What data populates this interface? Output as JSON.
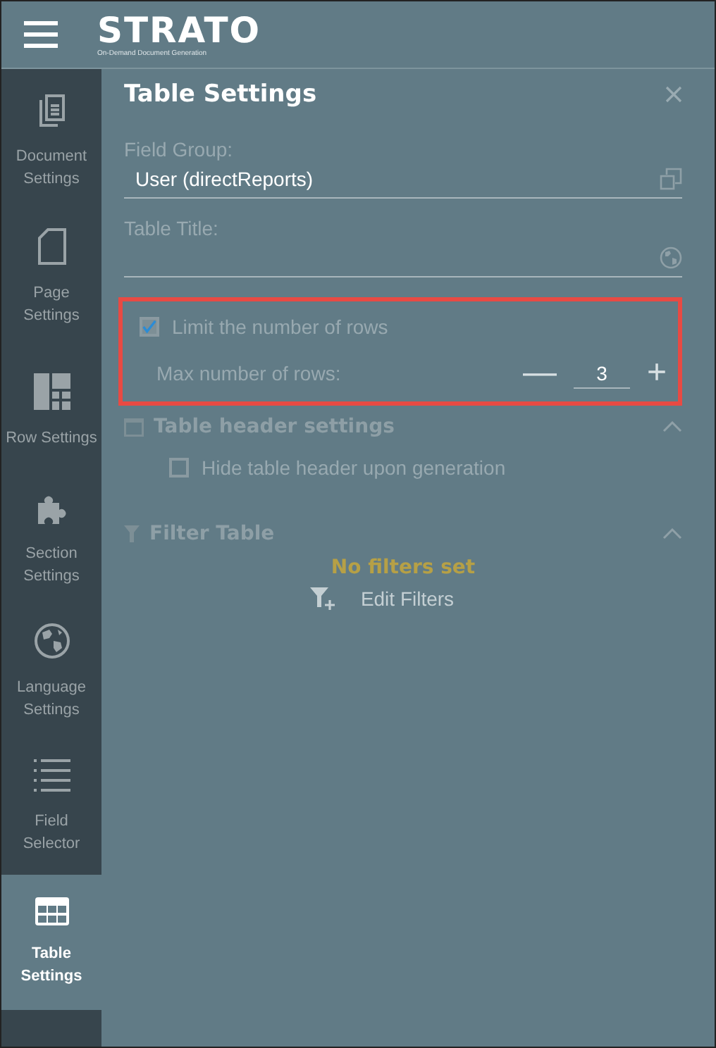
{
  "header": {
    "logo": "STRATO",
    "tagline": "On-Demand Document Generation"
  },
  "sidebar": {
    "items": [
      {
        "label": "Document Settings",
        "selected": false
      },
      {
        "label": "Page Settings",
        "selected": false
      },
      {
        "label": "Row Settings",
        "selected": false
      },
      {
        "label": "Section Settings",
        "selected": false
      },
      {
        "label": "Language Settings",
        "selected": false
      },
      {
        "label": "Field Selector",
        "selected": false
      },
      {
        "label": "Table Settings",
        "selected": true
      }
    ]
  },
  "panel": {
    "title": "Table Settings",
    "fields": [
      {
        "label": "Field Group:",
        "value": "User (directReports)",
        "kind": "copy"
      },
      {
        "label": "Table Title:",
        "kind": "globe"
      }
    ],
    "limit": {
      "highlighted": true,
      "label": "Limit the number of rows",
      "checked": true,
      "max_label": "Max number of rows:",
      "minus": "—",
      "value": "3",
      "plus": "+"
    },
    "sections": [
      {
        "title": "Table header settings",
        "expanded": true,
        "kind": "header",
        "options": [
          {
            "label": "Hide table header upon generation",
            "checked": false
          }
        ]
      },
      {
        "title": "Filter Table",
        "expanded": true,
        "kind": "filter",
        "empty": "No filters set",
        "action": "Edit Filters"
      }
    ]
  }
}
